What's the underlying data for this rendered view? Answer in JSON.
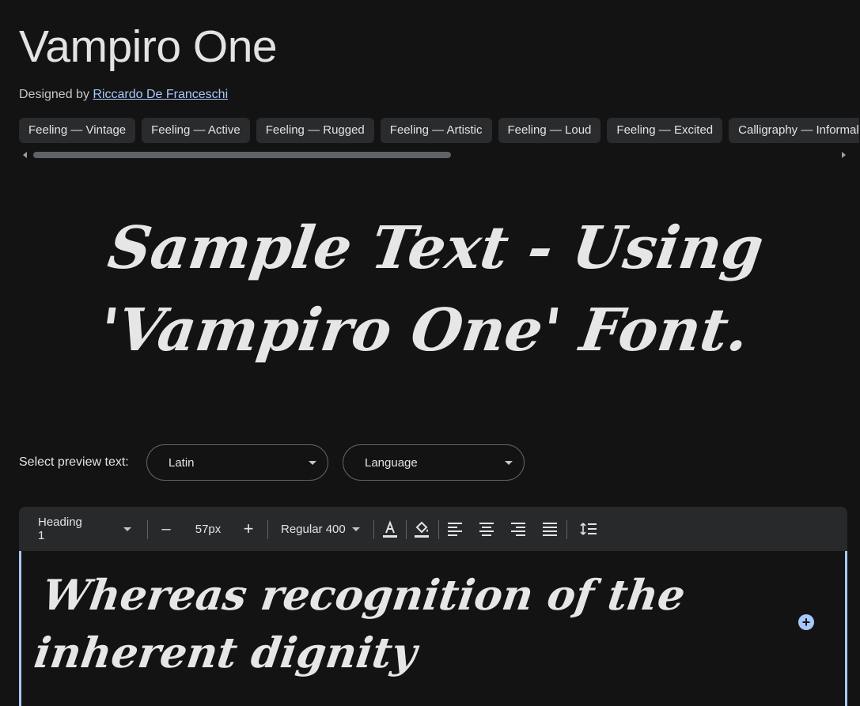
{
  "font": {
    "name": "Vampiro One",
    "designed_by_prefix": "Designed by",
    "designer": "Riccardo De Franceschi"
  },
  "tags": [
    "Feeling — Vintage",
    "Feeling — Active",
    "Feeling — Rugged",
    "Feeling — Artistic",
    "Feeling — Loud",
    "Feeling — Excited",
    "Calligraphy — Informal"
  ],
  "sample_text": "Sample Text - Using 'Vampiro One' Font.",
  "preview": {
    "label": "Select preview text:",
    "script_value": "Latin",
    "language_value": "Language"
  },
  "toolbar": {
    "style_value": "Heading 1",
    "minus": "–",
    "size_value": "57px",
    "plus": "+",
    "weight_value": "Regular 400"
  },
  "editor": {
    "text": "Whereas recognition of the inherent dignity",
    "add": "+"
  },
  "colors": {
    "background": "#131314",
    "accent": "#a8c7fa",
    "chip": "#2a2b2d"
  }
}
